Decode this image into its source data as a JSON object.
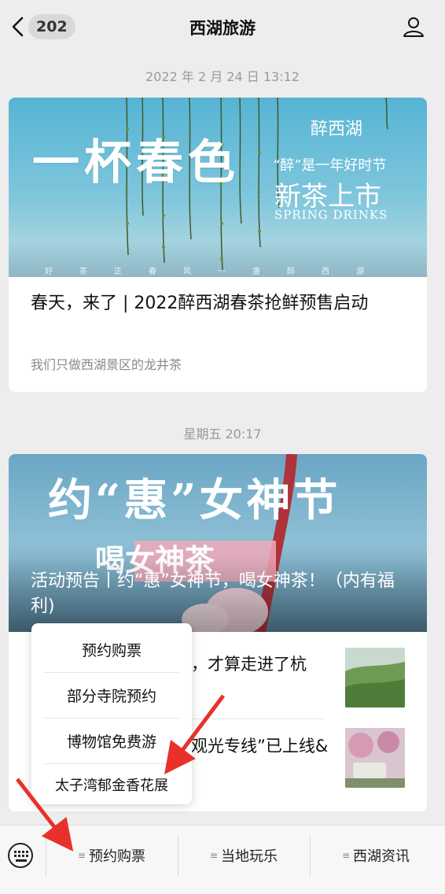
{
  "header": {
    "back_badge": "202",
    "title": "西湖旅游"
  },
  "feed": {
    "timestamp1": "2022 年 2 月 24 日 13:12",
    "article1": {
      "cover_big": "一杯春色",
      "cover_brand": "醉西湖",
      "cover_sub1": "“醉”是一年好时节",
      "cover_sub2": "新茶上市",
      "cover_sub3": "SPRING DRINKS",
      "cover_footer": "好茶正春风一盏醉西湖",
      "title": "春天，来了 | 2022醉西湖春茶抢鲜预售启动",
      "desc": "我们只做西湖景区的龙井茶"
    },
    "timestamp2": "星期五 20:17",
    "article2": {
      "cover_title": "约“惠”女神节",
      "cover_sub": "喝女神茶",
      "caption": "活动预告丨约“惠”女神节，喝女神茶！（内有福利)",
      "row1": "，才算走进了杭",
      "row2": "观光专线”已上线&"
    }
  },
  "popup": {
    "items": [
      "预约购票",
      "部分寺院预约",
      "博物馆免费游",
      "太子湾郁金香花展"
    ]
  },
  "bottom_bar": {
    "tabs": [
      "预约购票",
      "当地玩乐",
      "西湖资讯"
    ],
    "tab_marker": "≡"
  },
  "colors": {
    "background": "#ededed",
    "annotation_arrow": "#e8312a"
  }
}
